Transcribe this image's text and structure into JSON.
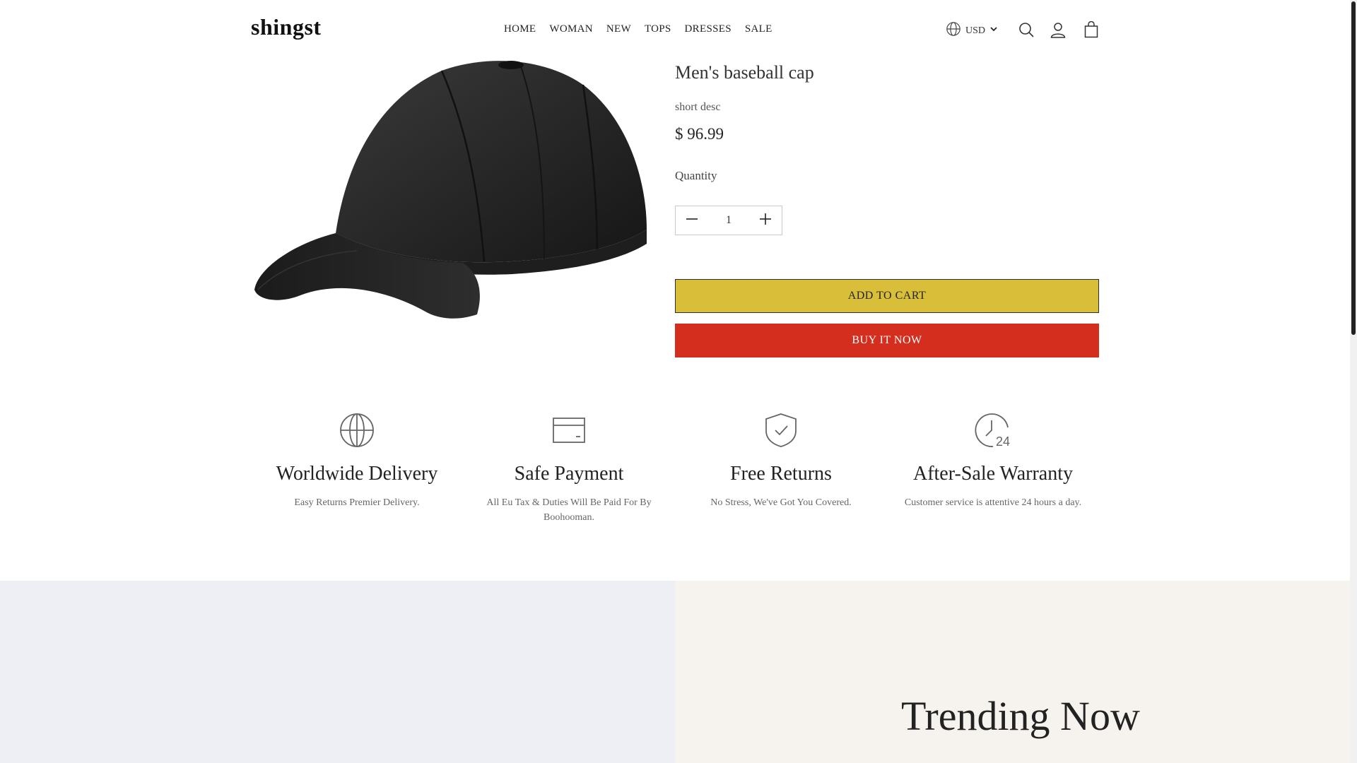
{
  "header": {
    "logo": "shingst",
    "nav": [
      "HOME",
      "WOMAN",
      "NEW",
      "TOPS",
      "DRESSES",
      "SALE"
    ],
    "currency": "USD",
    "icons": [
      "globe-icon",
      "chevron-down-icon",
      "search-icon",
      "user-icon",
      "cart-icon"
    ]
  },
  "product": {
    "image": "black-baseball-cap",
    "title": "Men's baseball cap",
    "short_desc": "short desc",
    "price": "$ 96.99",
    "quantity_label": "Quantity",
    "quantity": "1",
    "add_to_cart": "ADD TO CART",
    "buy_now": "BUY IT NOW"
  },
  "features": [
    {
      "icon": "globe-icon",
      "title": "Worldwide Delivery",
      "desc": "Easy Returns Premier Delivery."
    },
    {
      "icon": "credit-card-icon",
      "title": "Safe Payment",
      "desc": "All Eu Tax & Duties Will Be Paid For By Boohooman."
    },
    {
      "icon": "shield-check-icon",
      "title": "Free Returns",
      "desc": "No Stress, We've Got You Covered."
    },
    {
      "icon": "clock-24-icon",
      "title": "After-Sale Warranty",
      "desc": "Customer service is attentive 24 hours a day."
    }
  ],
  "banner": {
    "trending_title": "Trending Now"
  },
  "colors": {
    "add_to_cart_bg": "#d9be3a",
    "buy_now_bg": "#d42f1e",
    "banner_left_bg": "#eeeff4",
    "banner_right_bg": "#f6f3ef"
  }
}
